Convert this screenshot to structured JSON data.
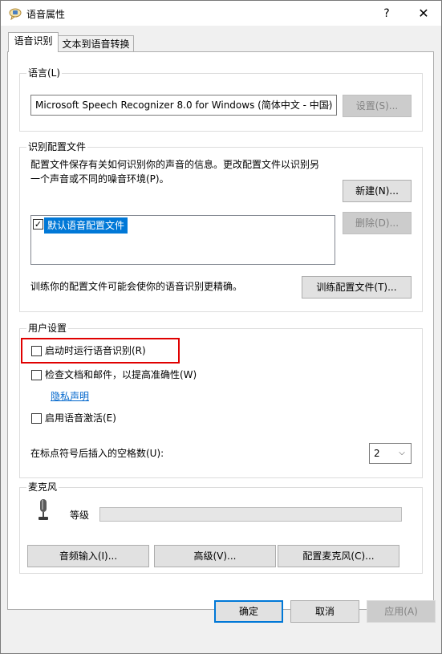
{
  "window": {
    "title": "语音属性",
    "help_glyph": "?",
    "close_glyph": "✕"
  },
  "tabs": [
    {
      "label": "语音识别",
      "active": true
    },
    {
      "label": "文本到语音转换",
      "active": false
    }
  ],
  "language": {
    "group_label": "语言(L)",
    "selected": "Microsoft Speech Recognizer 8.0 for Windows (简体中文 - 中国)",
    "settings_button": "设置(S)..."
  },
  "profile": {
    "group_label": "识别配置文件",
    "description": "配置文件保存有关如何识别你的声音的信息。更改配置文件以识别另一个声音或不同的噪音环境(P)。",
    "description_line1": "配置文件保存有关如何识别你的声音的信息。更改配置文件以识别另",
    "description_line2": "一个声音或不同的噪音环境(P)。",
    "new_button": "新建(N)...",
    "delete_button": "删除(D)...",
    "items": [
      {
        "label": "默认语音配置文件",
        "checked": true,
        "selected": true
      }
    ],
    "train_text": "训练你的配置文件可能会使你的语音识别更精确。",
    "train_button": "训练配置文件(T)..."
  },
  "user_settings": {
    "group_label": "用户设置",
    "run_at_startup": {
      "label": "启动时运行语音识别(R)",
      "checked": false
    },
    "review_documents": {
      "label": "检查文档和邮件，以提高准确性(W)",
      "checked": false
    },
    "privacy_link": "隐私声明",
    "voice_activation": {
      "label": "启用语音激活(E)",
      "checked": false
    },
    "spaces_label": "在标点符号后插入的空格数(U):",
    "spaces_value": "2"
  },
  "microphone": {
    "group_label": "麦克风",
    "level_label": "等级",
    "level": 0,
    "audio_input_button": "音频输入(I)...",
    "advanced_button": "高级(V)...",
    "configure_button": "配置麦克风(C)..."
  },
  "footer": {
    "ok": "确定",
    "cancel": "取消",
    "apply": "应用(A)"
  },
  "colors": {
    "selection": "#0078d7",
    "link": "#0066cc",
    "highlight_box": "#e00000"
  }
}
